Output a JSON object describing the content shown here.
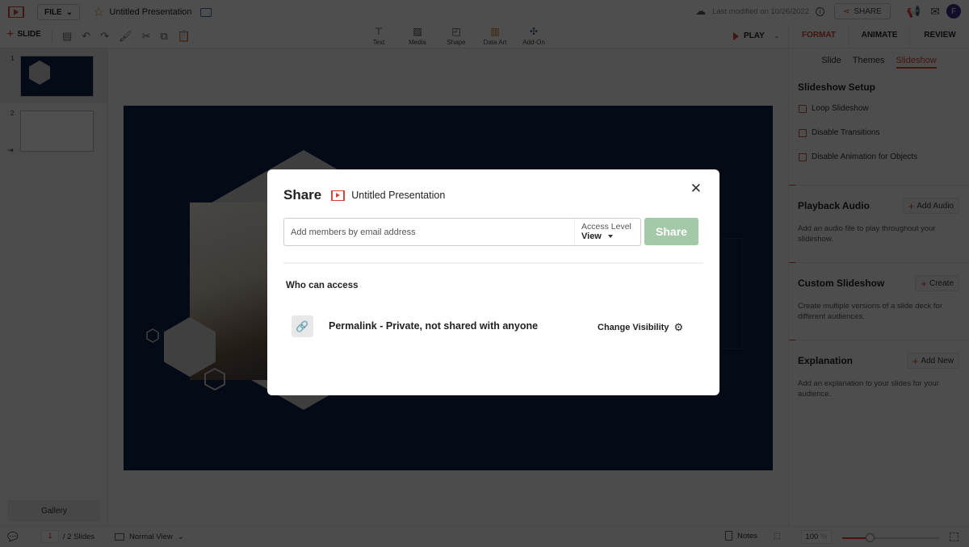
{
  "app": {
    "file_label": "FILE",
    "doc_title": "Untitled Presentation",
    "last_modified": "Last modified on 10/26/2022",
    "share_label": "SHARE",
    "avatar_initial": "F"
  },
  "toolbar": {
    "add_slide_label": "SLIDE",
    "insert": [
      {
        "label": "Text",
        "icon": "text-box-icon"
      },
      {
        "label": "Media",
        "icon": "image-icon"
      },
      {
        "label": "Shape",
        "icon": "shape-icon"
      },
      {
        "label": "Data Art",
        "icon": "data-art-icon"
      },
      {
        "label": "Add-On",
        "icon": "puzzle-icon"
      }
    ],
    "play_label": "PLAY",
    "right_tabs": [
      {
        "label": "FORMAT",
        "active": true
      },
      {
        "label": "ANIMATE",
        "active": false
      },
      {
        "label": "REVIEW",
        "active": false
      }
    ]
  },
  "slides_panel": {
    "slides": [
      {
        "number": "1",
        "selected": true
      },
      {
        "number": "2",
        "selected": false
      }
    ],
    "gallery_label": "Gallery"
  },
  "right_panel": {
    "subtabs": [
      {
        "label": "Slide",
        "active": false
      },
      {
        "label": "Themes",
        "active": false
      },
      {
        "label": "Slideshow",
        "active": true
      }
    ],
    "setup_title": "Slideshow Setup",
    "checkboxes": [
      {
        "label": "Loop Slideshow",
        "checked": false
      },
      {
        "label": "Disable Transitions",
        "checked": false
      },
      {
        "label": "Disable Animation for Objects",
        "checked": false
      }
    ],
    "sections": [
      {
        "title": "Playback Audio",
        "button": "Add Audio",
        "desc": "Add an audio file to play throughout your slideshow."
      },
      {
        "title": "Custom Slideshow",
        "button": "Create",
        "desc": "Create multiple versions of a slide deck for different audiences."
      },
      {
        "title": "Explanation",
        "button": "Add New",
        "desc": "Add an explanation to your slides for your audience."
      }
    ]
  },
  "statusbar": {
    "current_page": "1",
    "total": "/ 2 Slides",
    "view_label": "Normal View",
    "notes_label": "Notes",
    "zoom_value": "100",
    "zoom_unit": "%",
    "zoom_slider_fraction": 0.28
  },
  "share_dialog": {
    "title": "Share",
    "doc_name": "Untitled Presentation",
    "email_placeholder": "Add members by email address",
    "access_label": "Access Level",
    "access_value": "View",
    "share_button": "Share",
    "who_label": "Who can access",
    "permalink_text": "Permalink - Private, not shared with anyone",
    "change_visibility": "Change Visibility"
  },
  "colors": {
    "accent": "#d1483a",
    "share_button_disabled": "#a4c9a9",
    "slide_bg": "#0f2347",
    "avatar_bg": "#3b2a8c"
  }
}
